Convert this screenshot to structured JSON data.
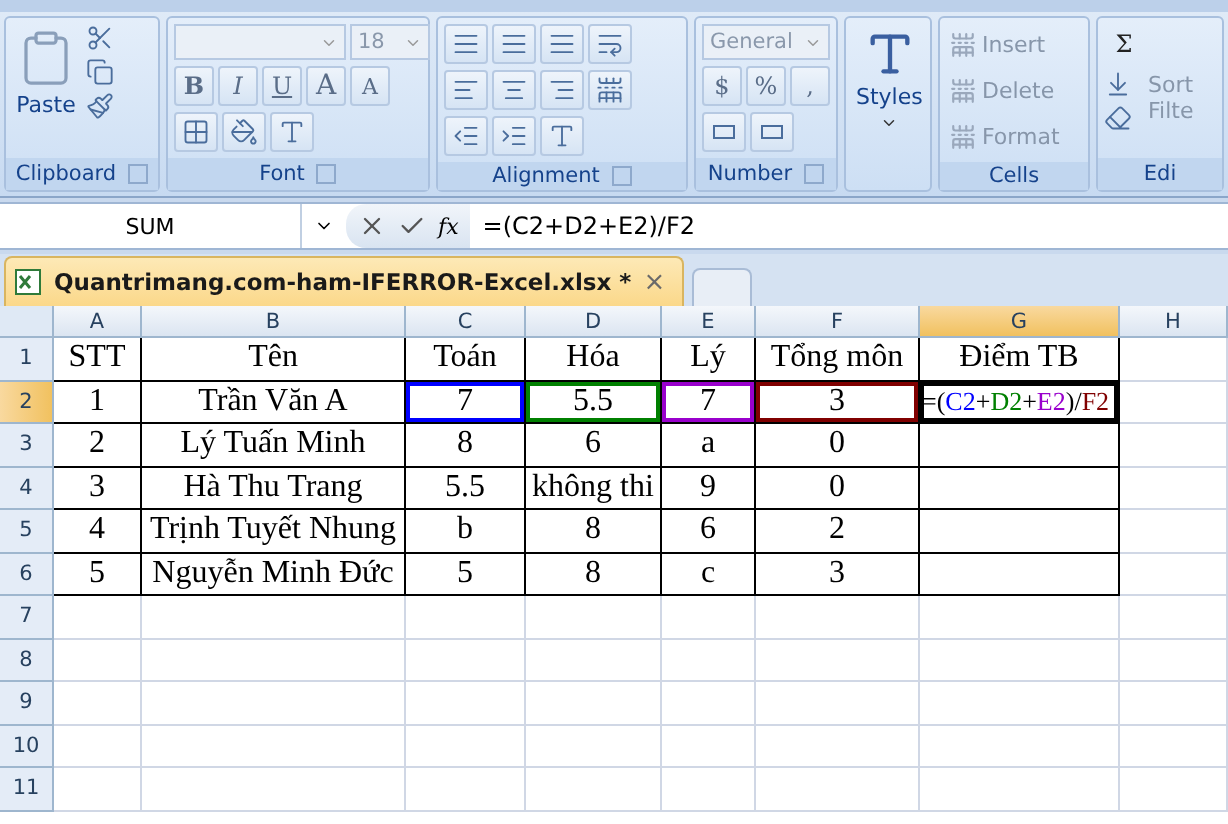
{
  "ribbon": {
    "groups": [
      {
        "kind": "clipboard",
        "label": "Clipboard",
        "paste": "Paste"
      },
      {
        "kind": "font",
        "label": "Font",
        "font_size": "18",
        "bold": "B",
        "italic": "I",
        "underline": "U",
        "grow": "A",
        "shrink": "A"
      },
      {
        "kind": "alignment",
        "label": "Alignment"
      },
      {
        "kind": "number",
        "label": "Number",
        "format": "General",
        "currency": "$",
        "percent": "%",
        "comma": ","
      },
      {
        "kind": "styles",
        "button": "Styles"
      },
      {
        "kind": "cells",
        "label": "Cells",
        "items": [
          "Insert",
          "Delete",
          "Format"
        ]
      },
      {
        "kind": "editing",
        "label": "Edi",
        "sum": "Σ",
        "sort": [
          "Sort",
          "Filte"
        ]
      }
    ]
  },
  "formula_bar": {
    "name_box": "SUM",
    "fx": "fx",
    "formula": "=(C2+D2+E2)/F2"
  },
  "workbook_tab": {
    "title": "Quantrimang.com-ham-IFERROR-Excel.xlsx *",
    "close": "×"
  },
  "sheet": {
    "columns": [
      {
        "label": "A",
        "selected": false
      },
      {
        "label": "B",
        "selected": false
      },
      {
        "label": "C",
        "selected": false
      },
      {
        "label": "D",
        "selected": false
      },
      {
        "label": "E",
        "selected": false
      },
      {
        "label": "F",
        "selected": false
      },
      {
        "label": "G",
        "selected": true
      },
      {
        "label": "H",
        "selected": false
      }
    ],
    "rows": [
      {
        "header": "1",
        "selected": false,
        "cells": [
          {
            "text": "STT"
          },
          {
            "text": "Tên"
          },
          {
            "text": "Toán"
          },
          {
            "text": "Hóa"
          },
          {
            "text": "Lý"
          },
          {
            "text": "Tổng môn"
          },
          {
            "text": "Điểm TB"
          }
        ]
      },
      {
        "header": "2",
        "selected": true,
        "cells": [
          {
            "text": "1"
          },
          {
            "text": "Trần Văn A"
          },
          {
            "text": "7",
            "color": "#0000ff"
          },
          {
            "text": "5.5",
            "color": "#008000"
          },
          {
            "text": "7",
            "color": "#9900cc"
          },
          {
            "text": "3",
            "color": "#800000"
          },
          {
            "parts": [
              {
                "text": "=(",
                "color": "#000000"
              },
              {
                "text": "C2",
                "color": "#0000ff"
              },
              {
                "text": "+",
                "color": "#000000"
              },
              {
                "text": "D2",
                "color": "#008000"
              },
              {
                "text": "+",
                "color": "#000000"
              },
              {
                "text": "E2",
                "color": "#9900cc"
              },
              {
                "text": ")/",
                "color": "#000000"
              },
              {
                "text": "F2",
                "color": "#800000"
              }
            ]
          }
        ]
      },
      {
        "header": "3",
        "selected": false,
        "cells": [
          {
            "text": "2"
          },
          {
            "text": "Lý Tuấn Minh"
          },
          {
            "text": "8"
          },
          {
            "text": "6"
          },
          {
            "text": "a"
          },
          {
            "text": "0"
          },
          {}
        ]
      },
      {
        "header": "4",
        "selected": false,
        "cells": [
          {
            "text": "3"
          },
          {
            "text": "Hà Thu Trang"
          },
          {
            "text": "5.5"
          },
          {
            "text": "không thi"
          },
          {
            "text": "9"
          },
          {
            "text": "0"
          },
          {}
        ]
      },
      {
        "header": "5",
        "selected": false,
        "cells": [
          {
            "text": "4"
          },
          {
            "text": "Trịnh Tuyết Nhung"
          },
          {
            "text": "b"
          },
          {
            "text": "8"
          },
          {
            "text": "6"
          },
          {
            "text": "2"
          },
          {}
        ]
      },
      {
        "header": "6",
        "selected": false,
        "cells": [
          {
            "text": "5"
          },
          {
            "text": "Nguyễn Minh Đức"
          },
          {
            "text": "5"
          },
          {
            "text": "8"
          },
          {
            "text": "c"
          },
          {
            "text": "3"
          },
          {}
        ]
      },
      {
        "header": "7",
        "selected": false
      },
      {
        "header": "8",
        "selected": false
      },
      {
        "header": "9",
        "selected": false
      },
      {
        "header": "10",
        "selected": false
      },
      {
        "header": "11",
        "selected": false
      }
    ]
  }
}
